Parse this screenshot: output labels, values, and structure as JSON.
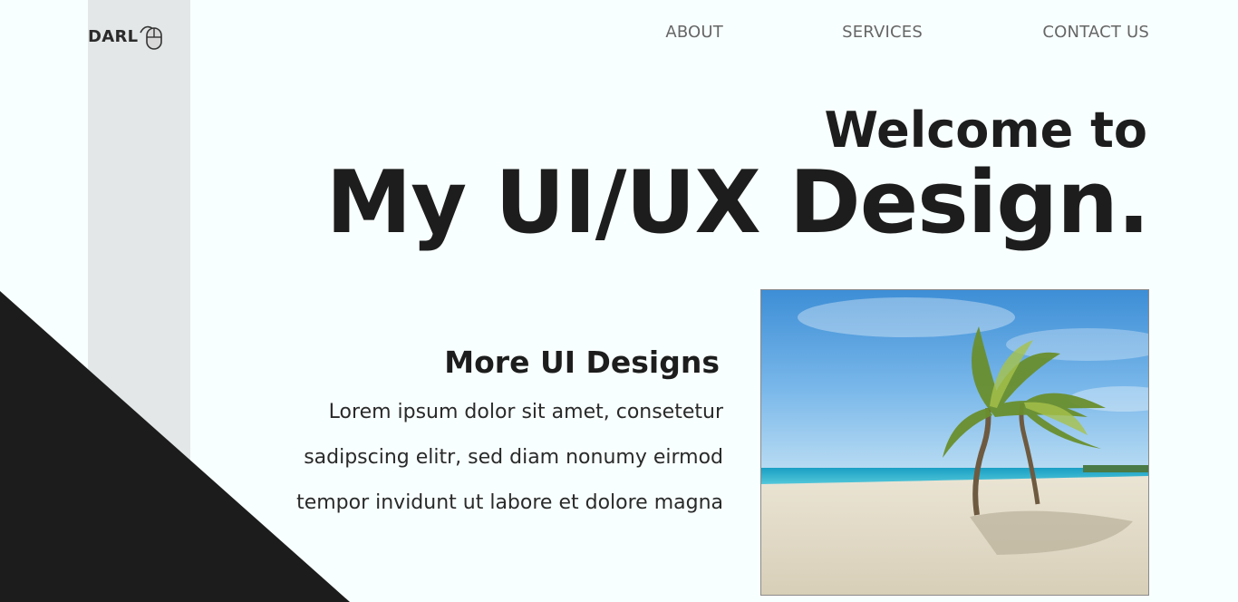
{
  "logo": {
    "text": "DARL",
    "icon": "computer-mouse-icon"
  },
  "nav": {
    "about": "ABOUT",
    "services": "SERVICES",
    "contact": "CONTACT US"
  },
  "hero": {
    "welcome": "Welcome to",
    "headline": "My UI/UX Design."
  },
  "section": {
    "title": "More UI Designs",
    "lines": [
      "Lorem ipsum dolor sit amet, consetetur",
      "sadipscing elitr, sed diam nonumy eirmod",
      "tempor invidunt ut labore et dolore magna"
    ]
  },
  "photo": {
    "subject": "palm-trees-beach-photo"
  },
  "colors": {
    "background": "#f8ffff",
    "side_band": "#e3e7e7",
    "dark_shape": "#1c1c1c",
    "text": "#1d1d1d",
    "nav_text": "#666666"
  }
}
